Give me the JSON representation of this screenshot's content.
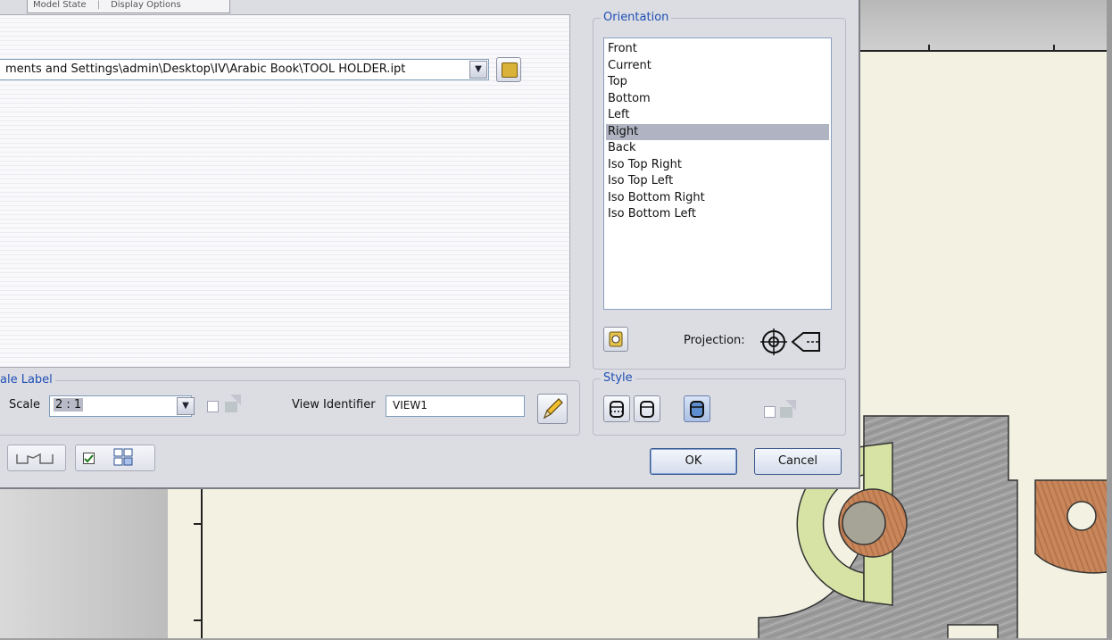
{
  "dialog": {
    "tabs": [
      "Model State",
      "Display Options"
    ],
    "file": {
      "path": "ments and Settings\\admin\\Desktop\\IV\\Arabic Book\\TOOL HOLDER.ipt"
    },
    "orientation": {
      "group_label": "Orientation",
      "items": [
        "Front",
        "Current",
        "Top",
        "Bottom",
        "Left",
        "Right",
        "Back",
        "Iso Top Right",
        "Iso Top Left",
        "Iso Bottom Right",
        "Iso Bottom Left"
      ],
      "selected": "Right",
      "projection_label": "Projection:"
    },
    "scale_label_group": "ale Label",
    "scale": {
      "label": "Scale",
      "value": "2 : 1"
    },
    "view_identifier": {
      "label": "View Identifier",
      "value": "VIEW1"
    },
    "style": {
      "group_label": "Style"
    },
    "buttons": {
      "ok": "OK",
      "cancel": "Cancel"
    }
  },
  "colors": {
    "dialog_bg": "#dcdde3",
    "group_label": "#1f4fb4",
    "selection": "#b0b4c2",
    "sheet": "#f2f1e2",
    "part_green": "#d6e3a4",
    "part_wood": "#c8865a",
    "part_metal": "#9a9a9a"
  }
}
